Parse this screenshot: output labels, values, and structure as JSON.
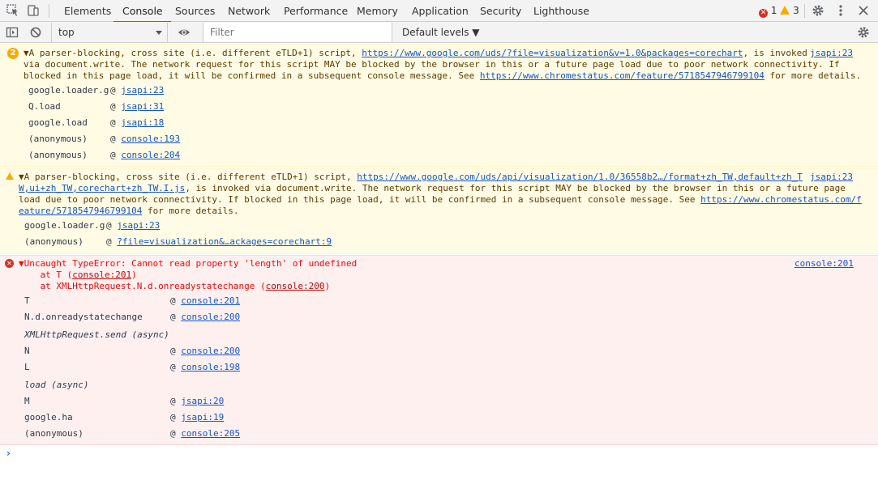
{
  "tabs": [
    {
      "label": "Elements"
    },
    {
      "label": "Console"
    },
    {
      "label": "Sources"
    },
    {
      "label": "Network"
    },
    {
      "label": "Performance"
    },
    {
      "label": "Memory"
    },
    {
      "label": "Application"
    },
    {
      "label": "Security"
    },
    {
      "label": "Lighthouse"
    }
  ],
  "counts": {
    "errors": "1",
    "warnings": "3"
  },
  "toolbar": {
    "context": "top",
    "filter_placeholder": "Filter",
    "levels": "Default levels ▼"
  },
  "colors": {
    "accent": "#1a73e8",
    "warn_bg": "#fffbe5",
    "error_bg": "#fff0f0",
    "error_text": "#ff0000",
    "link": "#1155cc"
  },
  "messages": {
    "warn1": {
      "count": "2",
      "l1_pre": "▼A parser-blocking, cross site (i.e. different eTLD+1) script, ",
      "l1_url": "https://www.google.com/uds/?file=visualization&v=1.0&packages=corechart",
      "l1_post": ", is invoked",
      "source": "jsapi:23",
      "l2": "via document.write. The network request for this script MAY be blocked by the browser in this or a future page load due to poor network connectivity. If",
      "l3_pre": "blocked in this page load, it will be confirmed in a subsequent console message. See ",
      "l3_url": "https://www.chromestatus.com/feature/5718547946799104",
      "l3_post": " for more details.",
      "stack": [
        {
          "fn": "google.loader.g",
          "loc": "jsapi:23"
        },
        {
          "fn": "Q.load",
          "loc": "jsapi:31"
        },
        {
          "fn": "google.load",
          "loc": "jsapi:18"
        },
        {
          "fn": "(anonymous)",
          "loc": "console:193"
        },
        {
          "fn": "(anonymous)",
          "loc": "console:204"
        }
      ]
    },
    "warn2": {
      "l1_pre": "▼A parser-blocking, cross site (i.e. different eTLD+1) script, ",
      "l1_url": "https://www.google.com/uds/api/visualization/1.0/36558b2…/format+zh_TW,default+zh_T",
      "source": "jsapi:23",
      "l2_url": "W,ui+zh_TW,corechart+zh_TW.I.js",
      "l2_post": ", is invoked via document.write. The network request for this script MAY be blocked by the browser in this or a future page",
      "l3_pre": "load due to poor network connectivity. If blocked in this page load, it will be confirmed in a subsequent console message. See ",
      "l3_url": "https://www.chromestatus.com/f",
      "l4_url": "eature/5718547946799104",
      "l4_post": " for more details.",
      "stack": [
        {
          "fn": "google.loader.g",
          "loc": "jsapi:23"
        },
        {
          "fn": "(anonymous)",
          "loc": "?file=visualization&…ackages=corechart:9"
        }
      ]
    },
    "error1": {
      "l1": "▼Uncaught TypeError: Cannot read property 'length' of undefined",
      "source": "console:201",
      "l2_pre": "    at T (",
      "l2_link": "console:201",
      "l2_post": ")",
      "l3_pre": "    at XMLHttpRequest.N.d.onreadystatechange (",
      "l3_link": "console:200",
      "l3_post": ")",
      "stack": [
        {
          "fn": "T",
          "loc": "console:201"
        },
        {
          "fn": "N.d.onreadystatechange",
          "loc": "console:200"
        },
        {
          "async": "XMLHttpRequest.send (async)"
        },
        {
          "fn": "N",
          "loc": "console:200"
        },
        {
          "fn": "L",
          "loc": "console:198"
        },
        {
          "async": "load (async)"
        },
        {
          "fn": "M",
          "loc": "jsapi:20"
        },
        {
          "fn": "google.ha",
          "loc": "jsapi:19"
        },
        {
          "fn": "(anonymous)",
          "loc": "console:205"
        }
      ]
    }
  }
}
